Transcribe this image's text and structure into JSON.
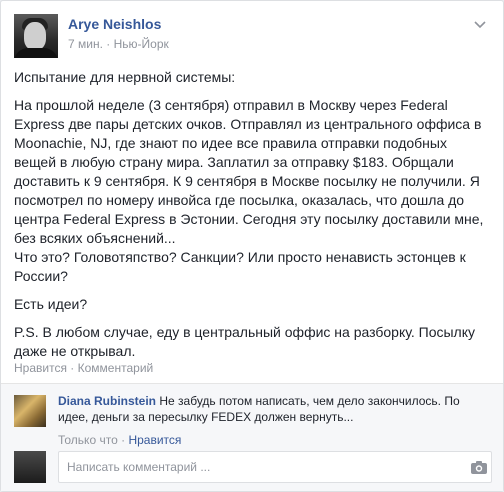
{
  "post": {
    "author": "Arye Neishlos",
    "time": "7 мин.",
    "separator": "·",
    "location": "Нью-Йорк",
    "paragraphs": [
      "Испытание для нервной системы:",
      "На прошлой неделе (3 сентября) отправил в Москву через Federal Express две пары детских очков. Отправлял из центрального оффиса в Moonachie, NJ, где знают по идее все правила отправки подобных вещей в любую страну мира. Заплатил за отправку $183. Обрщали доставить к 9 сентября. К 9 сентября в Москве посылку не получили. Я посмотрел по номеру инвойса где посылка, оказалась, что дошла до центра Federal Express в Эстонии. Сегодня эту посылку доставили мне, без всяких объяснений...\nЧто это? Головотяпство? Санкции? Или просто ненависть эстонцев к России?",
      "Есть идеи?",
      "P.S. В любом случае, еду в центральный оффис на разборку. Посылку даже не открывал."
    ],
    "like_label": "Нравится",
    "dot": "·",
    "comment_label": "Комментарий"
  },
  "comment": {
    "author": "Diana Rubinstein",
    "text": "Не забудь потом написать, чем дело закончилось. По идее, деньги за пересылку FEDEX должен вернуть...",
    "time": "Только что",
    "dot": "·",
    "like_label": "Нравится"
  },
  "composer": {
    "placeholder": "Написать комментарий ..."
  },
  "icons": {
    "chevron": "chevron-down-icon",
    "camera": "camera-icon"
  },
  "colors": {
    "link": "#365899",
    "meta": "#90949c",
    "text": "#1d2129"
  }
}
